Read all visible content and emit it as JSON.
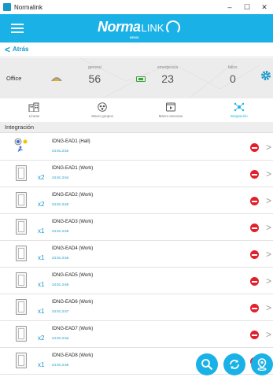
{
  "window": {
    "title": "Normalink",
    "minimize": "–",
    "maximize": "☐",
    "close": "✕"
  },
  "header": {
    "brand_bold": "Norma",
    "brand_light": "LINK",
    "brand_sub": "BEMS"
  },
  "nav": {
    "back_label": "Atrás"
  },
  "stats": {
    "room": "Office",
    "general_label": "general",
    "general_value": "56",
    "emergency_label": "emergencia",
    "emergency_value": "23",
    "faults_label": "fallos",
    "faults_value": "0"
  },
  "tabs": [
    {
      "label": "Líneas",
      "icon": "building-icon"
    },
    {
      "label": "Macro grupos",
      "icon": "bulb-group-icon"
    },
    {
      "label": "Macro escenas",
      "icon": "scene-icon"
    },
    {
      "label": "Integración",
      "icon": "network-icon"
    }
  ],
  "section_title": "Integración",
  "devices": [
    {
      "name": "IDNG-EAD1 (Hall)",
      "address": "24.91.3.5e",
      "multiplier": ""
    },
    {
      "name": "IDNG-EAD1 (Work)",
      "address": "24.91.3.64",
      "multiplier": "x2"
    },
    {
      "name": "IDNG-EAD2 (Work)",
      "address": "24.91.3.60",
      "multiplier": "x2"
    },
    {
      "name": "IDNG-EAD3 (Work)",
      "address": "24.91.3.68",
      "multiplier": "x1"
    },
    {
      "name": "IDNG-EAD4 (Work)",
      "address": "24.91.3.56",
      "multiplier": "x1"
    },
    {
      "name": "IDNG-EAD5 (Work)",
      "address": "24.91.3.66",
      "multiplier": "x1"
    },
    {
      "name": "IDNG-EAD6 (Work)",
      "address": "24.91.3.57",
      "multiplier": "x1"
    },
    {
      "name": "IDNG-EAD7 (Work)",
      "address": "24.91.3.5a",
      "multiplier": "x2"
    },
    {
      "name": "IDNG-EAD8 (Work)",
      "address": "24.91.3.56",
      "multiplier": "x1"
    }
  ],
  "colors": {
    "accent": "#1ab2e6",
    "delete": "#e2202c",
    "ok": "#3aa23a"
  }
}
